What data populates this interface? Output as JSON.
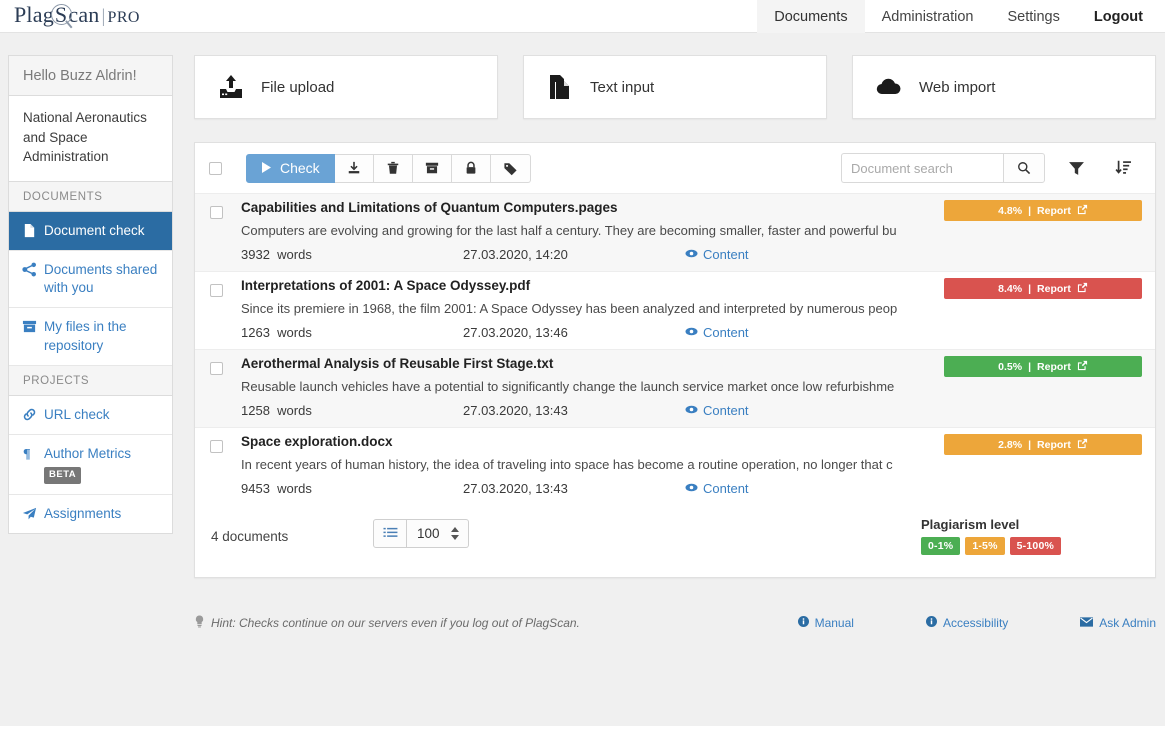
{
  "header": {
    "logo": {
      "pre": "Plag",
      "s": "S",
      "post": "can",
      "divider": "|",
      "pro": "PRO"
    },
    "nav": [
      {
        "label": "Documents",
        "active": true
      },
      {
        "label": "Administration",
        "active": false
      },
      {
        "label": "Settings",
        "active": false
      },
      {
        "label": "Logout",
        "active": false,
        "bold": true
      }
    ]
  },
  "sidebar": {
    "greeting": "Hello Buzz Aldrin!",
    "organization": "National Aeronautics and Space Administration",
    "section_documents": "DOCUMENTS",
    "section_projects": "PROJECTS",
    "items": [
      {
        "label": "Document check",
        "icon": "file-icon",
        "active": true
      },
      {
        "label": "Documents shared with you",
        "icon": "share-icon",
        "active": false
      },
      {
        "label": "My files in the repository",
        "icon": "archive-icon",
        "active": false
      },
      {
        "label": "URL check",
        "icon": "link-icon",
        "active": false
      },
      {
        "label": "Author Metrics",
        "icon": "paragraph-icon",
        "active": false,
        "badge": "BETA"
      },
      {
        "label": "Assignments",
        "icon": "paper-plane-icon",
        "active": false
      }
    ]
  },
  "cards": [
    {
      "label": "File upload",
      "icon": "upload-icon"
    },
    {
      "label": "Text input",
      "icon": "text-document-icon"
    },
    {
      "label": "Web import",
      "icon": "cloud-upload-icon"
    }
  ],
  "toolbar": {
    "check_label": "Check",
    "buttons": [
      {
        "name": "download-button",
        "icon": "download-icon"
      },
      {
        "name": "delete-button",
        "icon": "trash-icon"
      },
      {
        "name": "archive-button",
        "icon": "archive-icon"
      },
      {
        "name": "lock-button",
        "icon": "lock-icon"
      },
      {
        "name": "tag-button",
        "icon": "tag-icon"
      }
    ],
    "search_placeholder": "Document search",
    "search_value": "",
    "filter_icon": "filter-icon",
    "sort_icon": "sort-descending-icon"
  },
  "documents": [
    {
      "title": "Capabilities and Limitations of Quantum Computers.pages",
      "snippet": "Computers are evolving and growing for the last half a century. They are becoming smaller, faster and powerful bu",
      "words": "3932",
      "words_label": "words",
      "date": "27.03.2020, 14:20",
      "content_label": "Content",
      "percent": "4.8%",
      "report_label": "Report",
      "color": "#eda63a"
    },
    {
      "title": "Interpretations of 2001: A Space Odyssey.pdf",
      "snippet": "Since its premiere in 1968, the film 2001: A Space Odyssey has been analyzed and interpreted by numerous peop",
      "words": "1263",
      "words_label": "words",
      "date": "27.03.2020, 13:46",
      "content_label": "Content",
      "percent": "8.4%",
      "report_label": "Report",
      "color": "#d9534f"
    },
    {
      "title": "Aerothermal Analysis of Reusable First Stage.txt",
      "snippet": "Reusable launch vehicles have a potential to significantly change the launch service market once low refurbishme",
      "words": "1258",
      "words_label": "words",
      "date": "27.03.2020, 13:43",
      "content_label": "Content",
      "percent": "0.5%",
      "report_label": "Report",
      "color": "#4cae53"
    },
    {
      "title": "Space exploration.docx",
      "snippet": "In recent years of human history, the idea of traveling into space has become a routine operation, no longer that c",
      "words": "9453",
      "words_label": "words",
      "date": "27.03.2020, 13:43",
      "content_label": "Content",
      "percent": "2.8%",
      "report_label": "Report",
      "color": "#eda63a"
    }
  ],
  "panel_footer": {
    "documents_count": "4 documents",
    "page_size": "100",
    "legend_title": "Plagiarism level",
    "legend": [
      {
        "label": "0-1%",
        "color": "#4cae53"
      },
      {
        "label": "1-5%",
        "color": "#eda63a"
      },
      {
        "label": "5-100%",
        "color": "#d9534f"
      }
    ]
  },
  "footer": {
    "hint": "Hint: Checks continue on our servers even if you log out of PlagScan.",
    "links": [
      {
        "label": "Manual",
        "icon": "info-icon"
      },
      {
        "label": "Accessibility",
        "icon": "info-icon"
      },
      {
        "label": "Ask Admin",
        "icon": "mail-icon"
      }
    ]
  },
  "colors": {
    "accent": "#2b6ca3",
    "link": "#3a7fc1",
    "check_button": "#6aa3d5"
  }
}
